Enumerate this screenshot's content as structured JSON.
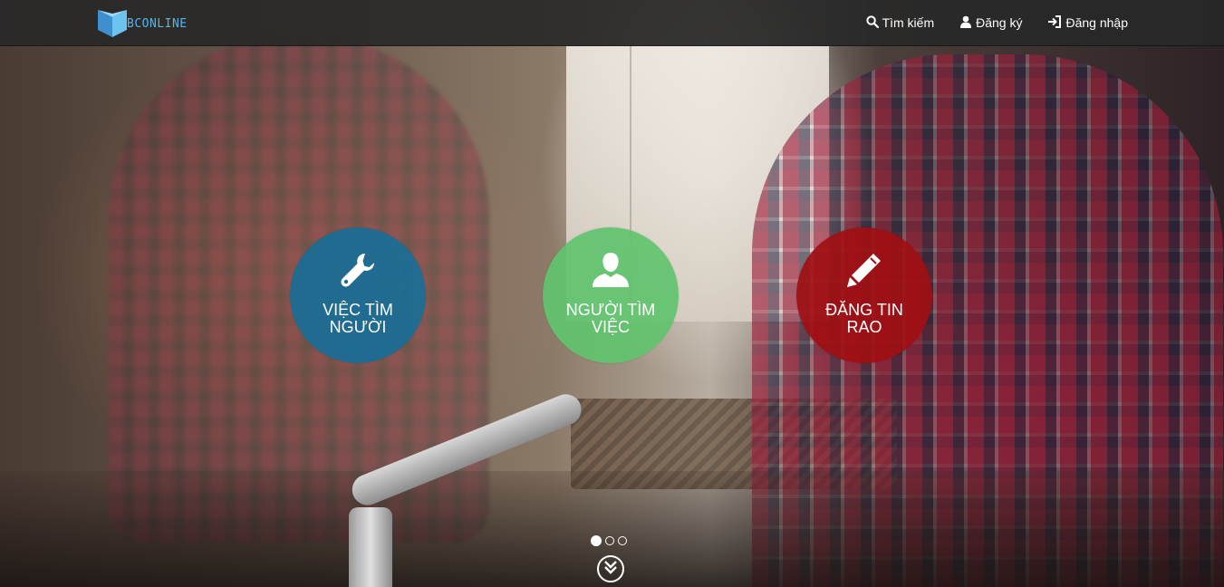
{
  "brand": {
    "name": "BCONLINE",
    "logo_icon": "cube-logo-icon",
    "color": "#59b4e6"
  },
  "nav": {
    "items": [
      {
        "label": "Tìm kiếm",
        "icon": "search-icon"
      },
      {
        "label": "Đăng ký",
        "icon": "user-icon"
      },
      {
        "label": "Đăng nhập",
        "icon": "sign-in-icon"
      }
    ]
  },
  "hero": {
    "circles": [
      {
        "label": "VIỆC TÌM NGƯỜI",
        "icon": "wrench-icon",
        "color": "#196e96"
      },
      {
        "label": "NGƯỜI TÌM VIỆC",
        "icon": "user-icon",
        "color": "#5fc36e"
      },
      {
        "label": "ĐĂNG TIN RAO",
        "icon": "pencil-icon",
        "color": "#a00f14"
      }
    ],
    "carousel": {
      "slides": 3,
      "active": 1
    },
    "scroll_icon": "chevron-double-down-icon"
  }
}
